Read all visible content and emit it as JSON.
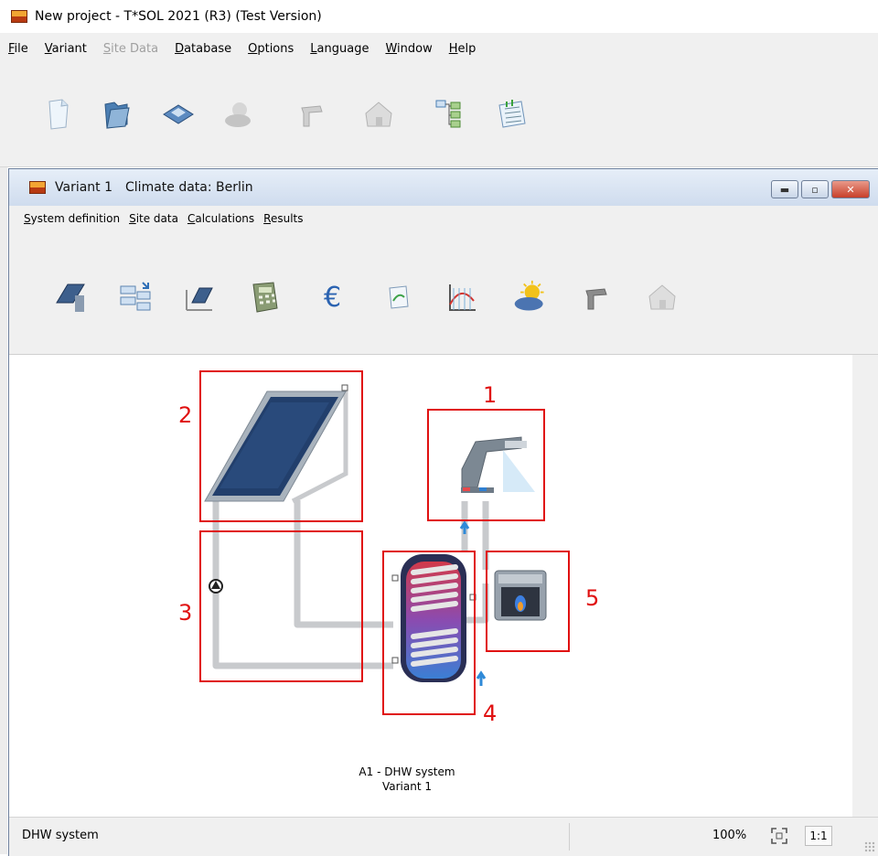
{
  "app": {
    "title": "New project - T*SOL 2021 (R3) (Test Version)",
    "menu": [
      {
        "label": "File",
        "enabled": true
      },
      {
        "label": "Variant",
        "enabled": true
      },
      {
        "label": "Site Data",
        "enabled": false
      },
      {
        "label": "Database",
        "enabled": true
      },
      {
        "label": "Options",
        "enabled": true
      },
      {
        "label": "Language",
        "enabled": true
      },
      {
        "label": "Window",
        "enabled": true
      },
      {
        "label": "Help",
        "enabled": true
      }
    ],
    "toolbar": [
      {
        "icon": "new-document-icon"
      },
      {
        "icon": "open-folder-icon"
      },
      {
        "icon": "save-disk-icon"
      },
      {
        "icon": "weather-icon",
        "enabled": false
      },
      {
        "icon": "tap-icon",
        "enabled": false
      },
      {
        "icon": "house-icon",
        "enabled": false
      },
      {
        "icon": "project-tree-icon"
      },
      {
        "icon": "report-icon"
      }
    ]
  },
  "variant_window": {
    "title": "Variant 1",
    "climate": "Climate data: Berlin",
    "menu": [
      "System definition",
      "Site data",
      "Calculations",
      "Results"
    ],
    "toolbar": [
      {
        "icon": "collector-icon"
      },
      {
        "icon": "system-components-icon"
      },
      {
        "icon": "collector-field-icon"
      },
      {
        "icon": "calculator-icon"
      },
      {
        "icon": "euro-icon"
      },
      {
        "icon": "chart-document-icon"
      },
      {
        "icon": "curve-chart-icon"
      },
      {
        "icon": "sun-cloud-icon"
      },
      {
        "icon": "tap-icon"
      },
      {
        "icon": "house-icon"
      }
    ],
    "diagram": {
      "caption_line1": "A1 - DHW system",
      "caption_line2": "Variant 1",
      "callouts": [
        "1",
        "2",
        "3",
        "4",
        "5"
      ]
    },
    "status": {
      "system": "DHW system",
      "zoom": "100%",
      "one_to_one": "1:1"
    }
  },
  "colors": {
    "callout_red": "#e01010",
    "pipe_gray": "#c8cacd",
    "collector_blue": "#1f3f73",
    "tank_hot": "#d23a4a",
    "tank_cold": "#3b7fd4"
  }
}
